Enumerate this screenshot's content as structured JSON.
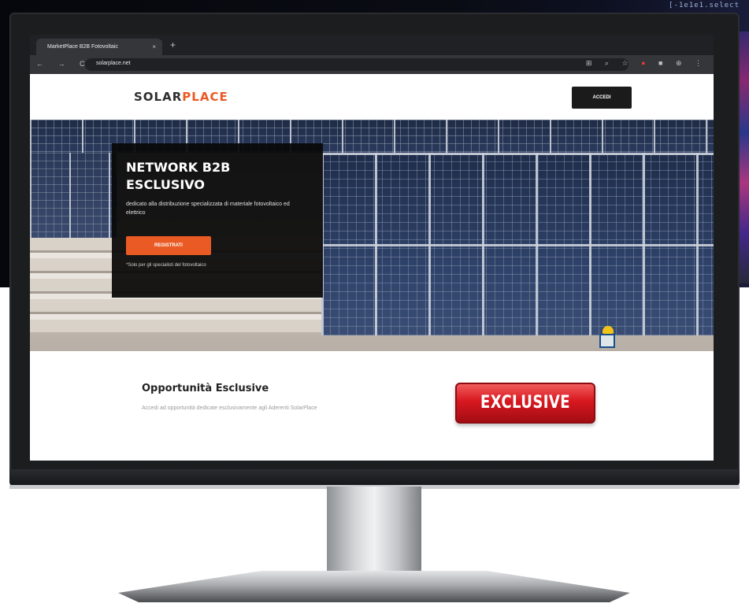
{
  "background": {
    "code_snippet": "[-1e1e1.select",
    "accent_color": "#ea5a24"
  },
  "browser": {
    "tab_title": "MarketPlace B2B Fotovoltaic",
    "tab_close": "×",
    "new_tab": "+",
    "nav_icons": "← → C",
    "url": "solarplace.net",
    "toolbar_icons": "⊞ ⌕ ☆",
    "toolbar_icons_right": "■ ⊕ ⋮"
  },
  "site": {
    "logo_part1": "SOLAR",
    "logo_part2": "PLACE",
    "login_label": "ACCEDI"
  },
  "hero": {
    "title": "NETWORK B2B ESCLUSIVO",
    "subtitle": "dedicato alla distribuzione specializzata di materiale fotovoltaico ed elettrico",
    "cta_label": "REGISTRATI",
    "note": "*Solo per gli specialisti del fotovoltaico"
  },
  "section": {
    "title": "Opportunità Esclusive",
    "text": "Accedi ad opportunità dedicate esclusivamente agli Aderenti SolarPlace",
    "badge": "EXCLUSIVE"
  }
}
